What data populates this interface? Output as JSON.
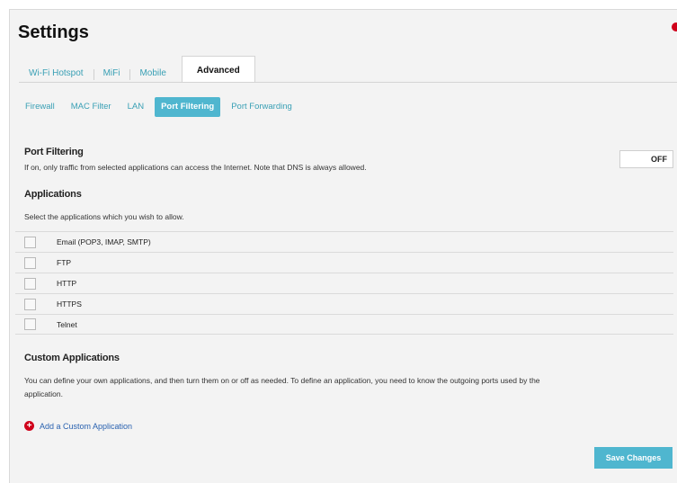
{
  "page": {
    "title": "Settings"
  },
  "main_tabs": [
    {
      "label": "Wi-Fi Hotspot",
      "active": false
    },
    {
      "label": "MiFi",
      "active": false
    },
    {
      "label": "Mobile",
      "active": false
    },
    {
      "label": "Advanced",
      "active": true
    }
  ],
  "sub_tabs": [
    {
      "label": "Firewall",
      "active": false
    },
    {
      "label": "MAC Filter",
      "active": false
    },
    {
      "label": "LAN",
      "active": false
    },
    {
      "label": "Port Filtering",
      "active": true
    },
    {
      "label": "Port Forwarding",
      "active": false
    }
  ],
  "port_filtering": {
    "heading": "Port Filtering",
    "description": "If on, only traffic from selected applications can access the Internet. Note that DNS is always allowed.",
    "toggle_label": "OFF"
  },
  "applications": {
    "heading": "Applications",
    "description": "Select the applications which you wish to allow.",
    "items": [
      {
        "label": "Email (POP3, IMAP, SMTP)",
        "checked": false
      },
      {
        "label": "FTP",
        "checked": false
      },
      {
        "label": "HTTP",
        "checked": false
      },
      {
        "label": "HTTPS",
        "checked": false
      },
      {
        "label": "Telnet",
        "checked": false
      }
    ]
  },
  "custom_applications": {
    "heading": "Custom Applications",
    "description_line1": "You can define your own applications, and then turn them on or off as needed. To define an application, you need to know the outgoing ports used by the",
    "description_line2": "application.",
    "add_label": "Add a Custom Application"
  },
  "actions": {
    "save_label": "Save Changes"
  },
  "colors": {
    "accent": "#4fb6cf",
    "link": "#3aa0b5",
    "alert": "#d0021b",
    "background": "#f3f3f3"
  },
  "icons": {
    "add": "plus-circle-icon",
    "notification": "notification-dot-icon"
  }
}
